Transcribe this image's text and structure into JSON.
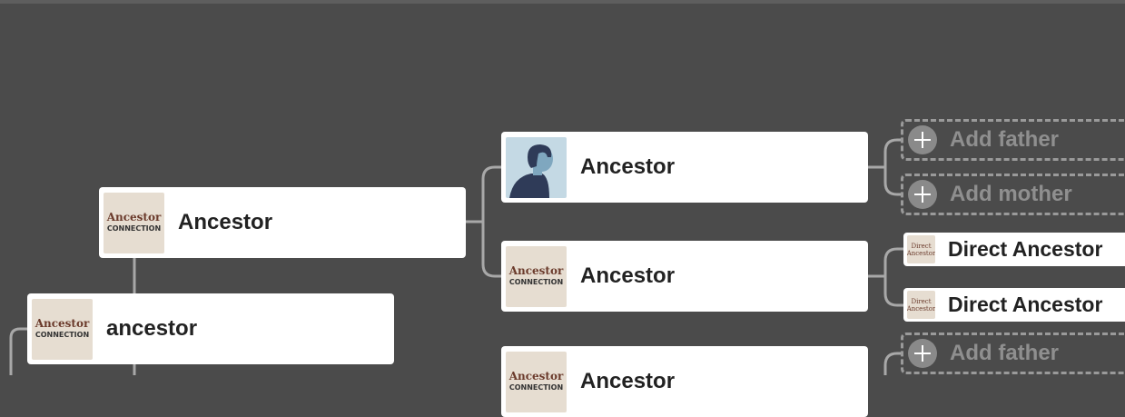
{
  "tree": {
    "root": {
      "name": "ancestor",
      "photo": "ancestor-connection-logo"
    },
    "parent": {
      "name": "Ancestor",
      "photo": "ancestor-connection-logo"
    },
    "grandparents": [
      {
        "name": "Ancestor",
        "photo": "silhouette-avatar"
      },
      {
        "name": "Ancestor",
        "photo": "ancestor-connection-logo"
      },
      {
        "name": "Ancestor",
        "photo": "ancestor-connection-logo"
      }
    ],
    "great_grandparents": [
      {
        "name": "Direct Ancestor",
        "photo": "ancestor-connection-logo"
      },
      {
        "name": "Direct Ancestor",
        "photo": "ancestor-connection-logo"
      }
    ],
    "add_father_label": "Add father",
    "add_mother_label": "Add mother"
  },
  "logo": {
    "line1": "Ancestor",
    "line2": "CONNECTION",
    "mini_line1": "Direct",
    "mini_line2": "Ancestor"
  },
  "colors": {
    "background": "#4b4b4b",
    "connector": "#a8a8a8",
    "card": "#ffffff",
    "placeholder": "#8f8f8f"
  }
}
